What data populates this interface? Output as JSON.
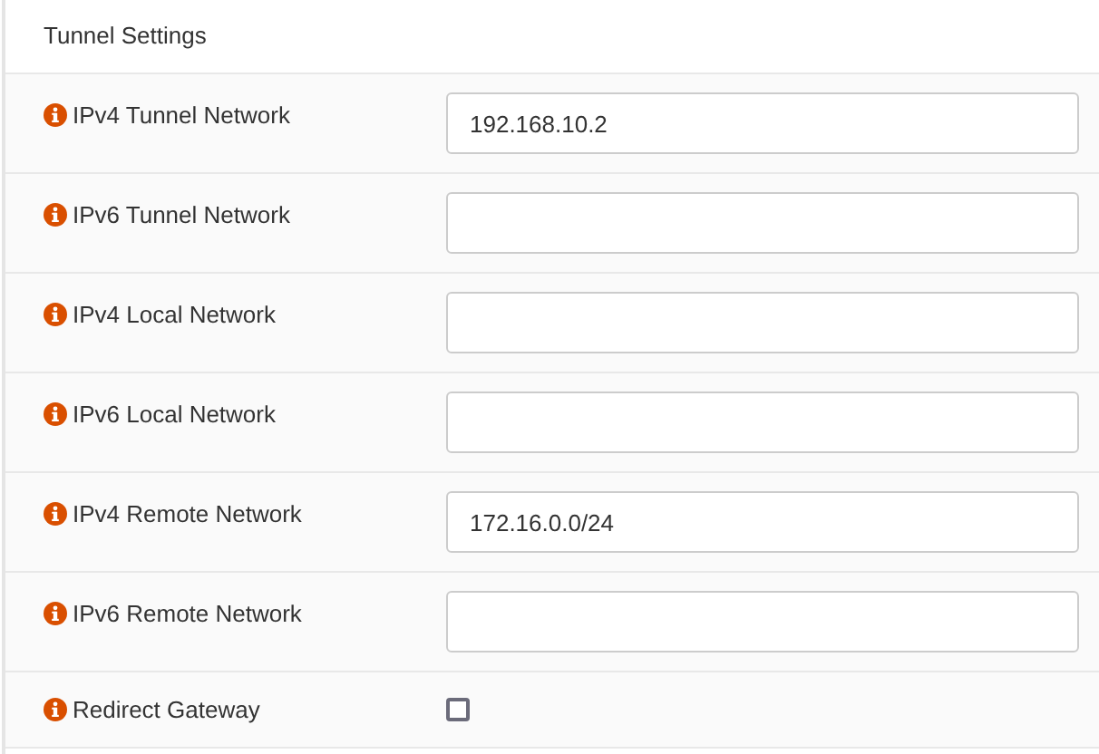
{
  "section_title": "Tunnel Settings",
  "fields": [
    {
      "kind": "text",
      "label": "IPv4 Tunnel Network",
      "value": "192.168.10.2"
    },
    {
      "kind": "text",
      "label": "IPv6 Tunnel Network"
    },
    {
      "kind": "text",
      "label": "IPv4 Local Network"
    },
    {
      "kind": "text",
      "label": "IPv6 Local Network"
    },
    {
      "kind": "text",
      "label": "IPv4 Remote Network",
      "value": "172.16.0.0/24"
    },
    {
      "kind": "text",
      "label": "IPv6 Remote Network"
    },
    {
      "kind": "checkbox",
      "label": "Redirect Gateway",
      "checked": false
    }
  ]
}
